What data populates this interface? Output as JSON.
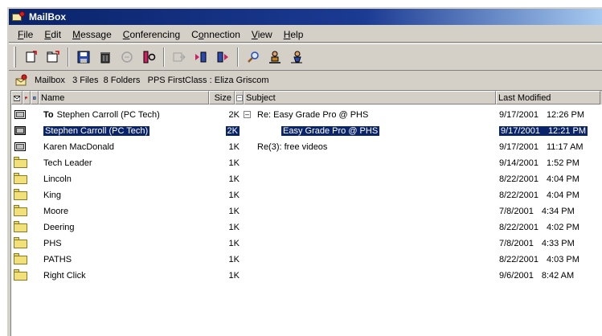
{
  "window": {
    "title": "MailBox"
  },
  "menu": [
    "File",
    "Edit",
    "Message",
    "Conferencing",
    "Connection",
    "View",
    "Help"
  ],
  "menu_underline": [
    "F",
    "E",
    "M",
    "C",
    "o",
    "V",
    "H"
  ],
  "toolbar": {
    "buttons": [
      {
        "icon": "new-document-icon"
      },
      {
        "icon": "new-folder-icon"
      },
      {
        "icon": "save-icon"
      },
      {
        "icon": "delete-trash-icon"
      },
      {
        "icon": "disabled-icon"
      },
      {
        "icon": "conference-icon"
      },
      {
        "icon": "forward-disabled-icon"
      },
      {
        "icon": "previous-message-icon"
      },
      {
        "icon": "next-message-icon"
      },
      {
        "icon": "find-icon"
      },
      {
        "icon": "user-icon"
      },
      {
        "icon": "resume-icon"
      }
    ]
  },
  "path": {
    "text": "Mailbox   3 Files  8 Folders   PPS FirstClass : Eliza Griscom"
  },
  "columns": {
    "name": "Name",
    "size": "Size",
    "subject": "Subject",
    "modified": "Last Modified"
  },
  "rows": [
    {
      "type": "message",
      "name": "To  Stephen Carroll (PC Tech)",
      "to_prefix": true,
      "size": "2K",
      "toggle": "⊟",
      "subject": "Re: Easy Grade Pro @ PHS",
      "date": "9/17/2001",
      "time": "12:26 PM",
      "selected": false
    },
    {
      "type": "message-dark",
      "name": "Stephen Carroll (PC Tech)",
      "size": "2K",
      "toggle": "",
      "subject": "Easy Grade Pro @ PHS",
      "date": "9/17/2001",
      "time": "12:21 PM",
      "selected": true
    },
    {
      "type": "message",
      "name": "Karen MacDonald",
      "size": "1K",
      "toggle": "",
      "subject": "Re(3): free videos",
      "date": "9/17/2001",
      "time": "11:17 AM",
      "selected": false
    },
    {
      "type": "folder",
      "name": "Tech Leader",
      "size": "1K",
      "toggle": "",
      "subject": "",
      "date": "9/14/2001",
      "time": "1:52 PM",
      "selected": false
    },
    {
      "type": "folder",
      "name": "Lincoln",
      "size": "1K",
      "toggle": "",
      "subject": "",
      "date": "8/22/2001",
      "time": "4:04 PM",
      "selected": false
    },
    {
      "type": "folder",
      "name": "King",
      "size": "1K",
      "toggle": "",
      "subject": "",
      "date": "8/22/2001",
      "time": "4:04 PM",
      "selected": false
    },
    {
      "type": "folder",
      "name": "Moore",
      "size": "1K",
      "toggle": "",
      "subject": "",
      "date": "7/8/2001",
      "time": "4:34 PM",
      "selected": false
    },
    {
      "type": "folder",
      "name": "Deering",
      "size": "1K",
      "toggle": "",
      "subject": "",
      "date": "8/22/2001",
      "time": "4:02 PM",
      "selected": false
    },
    {
      "type": "folder",
      "name": "PHS",
      "size": "1K",
      "toggle": "",
      "subject": "",
      "date": "7/8/2001",
      "time": "4:33 PM",
      "selected": false
    },
    {
      "type": "folder",
      "name": "PATHS",
      "size": "1K",
      "toggle": "",
      "subject": "",
      "date": "8/22/2001",
      "time": "4:03 PM",
      "selected": false
    },
    {
      "type": "folder",
      "name": "Right Click",
      "size": "1K",
      "toggle": "",
      "subject": "",
      "date": "9/6/2001",
      "time": "8:42 AM",
      "selected": false
    }
  ],
  "colors": {
    "selection": "#0a246a",
    "titlebar": "#0a246a",
    "folder": "#f2e07a"
  }
}
